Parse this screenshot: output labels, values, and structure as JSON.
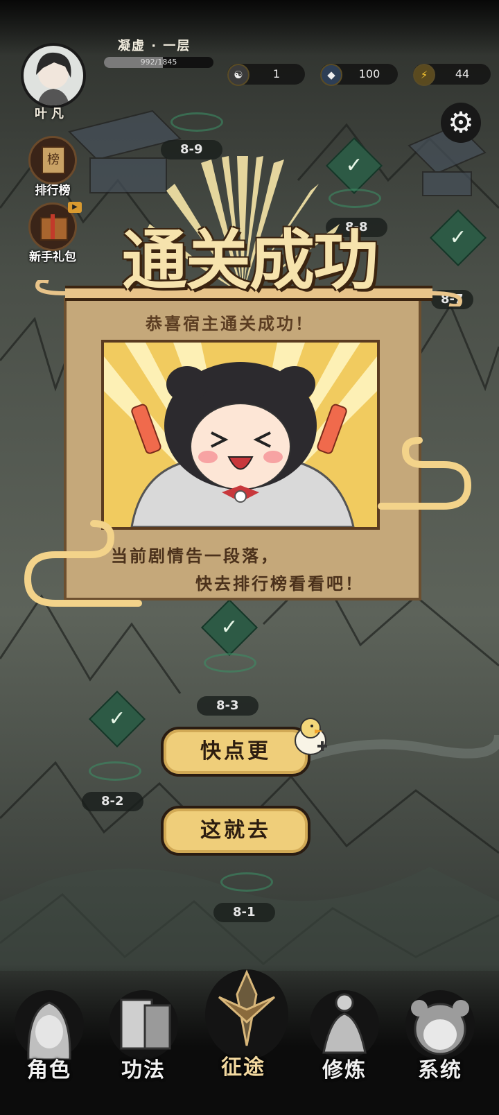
{
  "player": {
    "name": "叶凡",
    "realm": "凝虚 · 一层",
    "exp_text": "992/1845",
    "exp_fraction": 0.537
  },
  "resources": [
    {
      "icon": "yin-yang-icon",
      "value": "1"
    },
    {
      "icon": "spirit-stone-icon",
      "value": "100"
    },
    {
      "icon": "lightning-icon",
      "value": "44"
    }
  ],
  "side_buttons": {
    "leaderboard": "排行榜",
    "newbie_gift": "新手礼包"
  },
  "stages": {
    "s89": "8-9",
    "s88": "8-8",
    "s87": "8-7",
    "s83": "8-3",
    "s82": "8-2",
    "s81": "8-1"
  },
  "victory": {
    "title": "通关成功",
    "subtitle": "恭喜宿主通关成功！",
    "message_line1": "当前剧情告一段落，",
    "message_line2": "快去排行榜看看吧！",
    "btn_more": "快点更",
    "btn_go": "这就去"
  },
  "nav": [
    "角色",
    "功法",
    "征途",
    "修炼",
    "系统"
  ],
  "colors": {
    "gold": "#efce7a",
    "panel": "#c5a87a",
    "check": "#2d5a45"
  }
}
